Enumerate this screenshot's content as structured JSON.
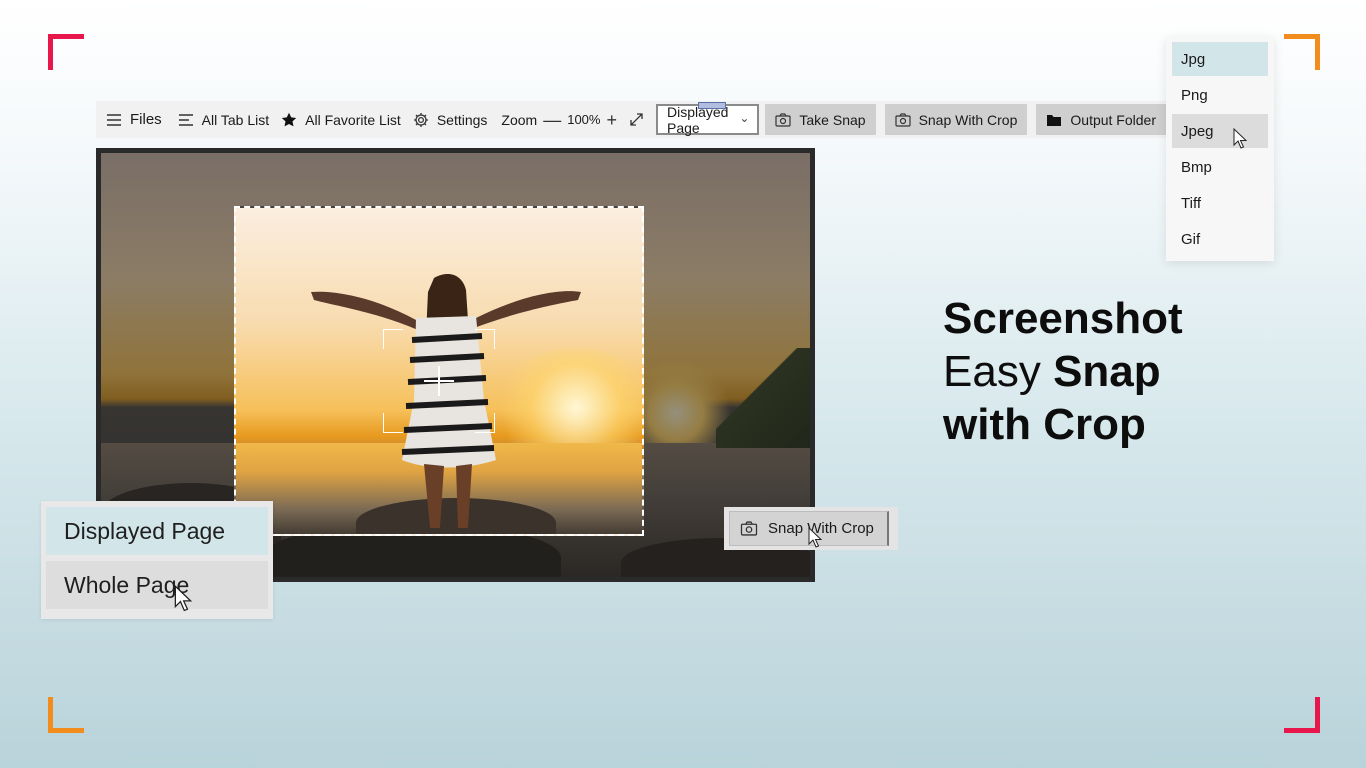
{
  "colors": {
    "corner_red": "#e8174b",
    "corner_orange": "#f28c1c",
    "selected_bg": "#d2e6ea",
    "button_bg": "#cfcfcf"
  },
  "toolbar": {
    "files_icon": "hamburger-icon",
    "files_label": "Files",
    "tablist_icon": "list-icon",
    "tablist_label": "All Tab List",
    "favorite_icon": "star-icon",
    "favorite_label": "All Favorite List",
    "settings_icon": "gear-icon",
    "settings_label": "Settings",
    "zoom_label": "Zoom",
    "zoom_minus": "—",
    "zoom_value": "100%",
    "zoom_plus": "+",
    "fullscreen_icon": "expand-icon",
    "page_select_value": "Displayed Page",
    "take_snap_label": "Take Snap",
    "snap_crop_label": "Snap With Crop",
    "output_folder_label": "Output Folder"
  },
  "format_menu": {
    "items": [
      {
        "label": "Jpg",
        "state": "selected"
      },
      {
        "label": "Png",
        "state": "normal"
      },
      {
        "label": "Jpeg",
        "state": "hover"
      },
      {
        "label": "Bmp",
        "state": "normal"
      },
      {
        "label": "Tiff",
        "state": "normal"
      },
      {
        "label": "Gif",
        "state": "normal"
      }
    ]
  },
  "headline": {
    "line1_bold": "Screenshot",
    "line2_light": "Easy",
    "line2_bold": "Snap",
    "line3_bold": "with Crop"
  },
  "mode_popup": {
    "items": [
      {
        "label": "Displayed Page",
        "state": "selected"
      },
      {
        "label": "Whole Page",
        "state": "hover"
      }
    ]
  },
  "snap_float": {
    "label": "Snap With Crop",
    "icon": "camera-icon"
  }
}
